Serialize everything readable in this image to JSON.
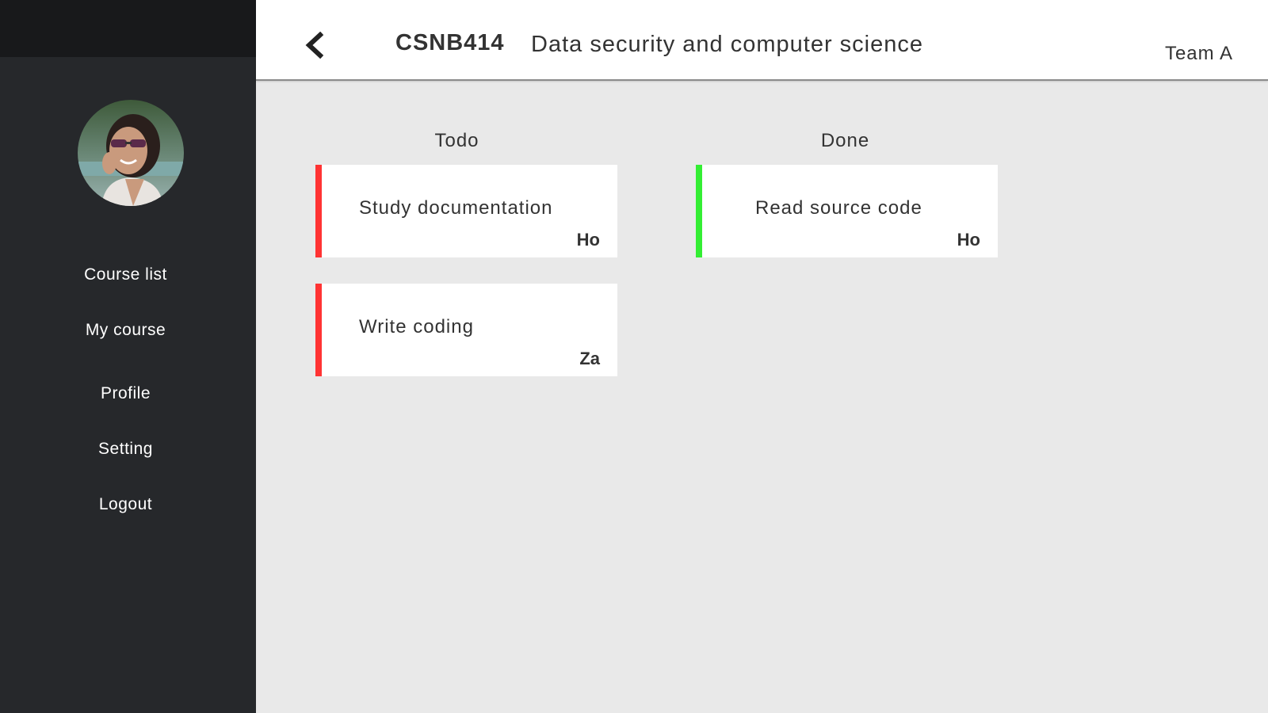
{
  "sidebar": {
    "nav": [
      {
        "label": "Course list"
      },
      {
        "label": "My course"
      },
      {
        "label": "Profile"
      },
      {
        "label": "Setting"
      },
      {
        "label": "Logout"
      }
    ]
  },
  "header": {
    "course_code": "CSNB414",
    "course_name": "Data security and computer science",
    "team": "Team A"
  },
  "board": {
    "columns": [
      {
        "title": "Todo",
        "accent": "#ff3333",
        "cards": [
          {
            "title": "Study documentation",
            "assignee": "Ho"
          },
          {
            "title": "Write coding",
            "assignee": "Za"
          }
        ]
      },
      {
        "title": "Done",
        "accent": "#33ee33",
        "cards": [
          {
            "title": "Read source code",
            "assignee": "Ho"
          }
        ]
      }
    ]
  },
  "icons": {
    "back": "chevron-left-icon",
    "avatar": "user-avatar"
  }
}
